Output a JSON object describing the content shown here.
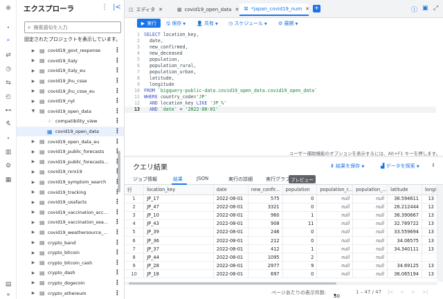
{
  "explorer": {
    "title": "エクスプローラ",
    "search_placeholder": "検索語句を入力",
    "pinned_note": "固定されたプロジェクトを表示しています。",
    "items": [
      {
        "label": "covid19_govt_response",
        "type": "dataset",
        "expanded": false
      },
      {
        "label": "covid19_italy",
        "type": "dataset",
        "expanded": false
      },
      {
        "label": "covid19_italy_eu",
        "type": "dataset",
        "expanded": false
      },
      {
        "label": "covid19_jhu_csse",
        "type": "dataset",
        "expanded": false
      },
      {
        "label": "covid19_jhu_csse_eu",
        "type": "dataset",
        "expanded": false
      },
      {
        "label": "covid19_nyt",
        "type": "dataset",
        "expanded": false
      },
      {
        "label": "covid19_open_data",
        "type": "dataset",
        "expanded": true
      },
      {
        "label": "compatibility_view",
        "type": "view",
        "child": true
      },
      {
        "label": "covid19_open_data",
        "type": "table",
        "child": true,
        "selected": true
      },
      {
        "label": "covid19_open_data_eu",
        "type": "dataset",
        "expanded": false
      },
      {
        "label": "covid19_public_forecasts",
        "type": "dataset",
        "expanded": false
      },
      {
        "label": "covid19_public_forecasts_asi...",
        "type": "dataset",
        "expanded": false
      },
      {
        "label": "covid19_rxrx19",
        "type": "dataset",
        "expanded": false
      },
      {
        "label": "covid19_symptom_search",
        "type": "dataset",
        "expanded": false
      },
      {
        "label": "covid19_tracking",
        "type": "dataset",
        "expanded": false
      },
      {
        "label": "covid19_usafacts",
        "type": "dataset",
        "expanded": false
      },
      {
        "label": "covid19_vaccination_access",
        "type": "dataset",
        "expanded": false
      },
      {
        "label": "covid19_vaccination_search_...",
        "type": "dataset",
        "expanded": false
      },
      {
        "label": "covid19_weathersource_com",
        "type": "dataset",
        "expanded": false
      },
      {
        "label": "crypto_band",
        "type": "dataset",
        "expanded": false
      },
      {
        "label": "crypto_bitcoin",
        "type": "dataset",
        "expanded": false
      },
      {
        "label": "crypto_bitcoin_cash",
        "type": "dataset",
        "expanded": false
      },
      {
        "label": "crypto_dash",
        "type": "dataset",
        "expanded": false
      },
      {
        "label": "crypto_dogecoin",
        "type": "dataset",
        "expanded": false
      },
      {
        "label": "crypto_ethereum",
        "type": "dataset",
        "expanded": false
      }
    ]
  },
  "tabs": [
    {
      "label": "エディタ",
      "icon": "editor-icon",
      "active": false
    },
    {
      "label": "covid19_open_data",
      "icon": "table-icon",
      "active": false
    },
    {
      "label": "*japan_covid19_num",
      "icon": "query-icon",
      "active": true
    }
  ],
  "toolbar": {
    "run": "実行",
    "save": "保存",
    "share": "共有",
    "schedule": "スケジュール",
    "deploy": "展開"
  },
  "code_lines": [
    "SELECT location_key,",
    "  date,",
    "  new_confirmed,",
    "  new_deceased",
    "  population,",
    "  population_rural,",
    "  population_urban,",
    "  latitude,",
    "  longitude",
    "FROM `bigquery-public-data.covid19_open_data.covid19_open_data`",
    "WHERE country_code='JP'",
    "  AND location_key LIKE 'JP_%'",
    "  AND `date` = '2022-08-01'"
  ],
  "current_line": 13,
  "a11y_hint": "ユーザー補助機能のオプションを表示するには、Alt+F1 キーを押します。",
  "results": {
    "title": "クエリ結果",
    "save_results": "結果を保存",
    "explore_data": "データを探索",
    "tabs": [
      "ジョブ情報",
      "結果",
      "JSON",
      "実行の詳細",
      "実行グラフ"
    ],
    "preview_badge": "プレビュー",
    "columns": [
      "行",
      "location_key",
      "date",
      "new_confir...",
      "population",
      "population_r...",
      "population_...",
      "latitude",
      "longi"
    ],
    "rows": [
      [
        "1",
        "JP_17",
        "2022-08-01",
        "575",
        "0",
        "null",
        "null",
        "36.594611",
        "13"
      ],
      [
        "2",
        "JP_47",
        "2022-08-01",
        "3321",
        "0",
        "null",
        "null",
        "26.212444",
        "12"
      ],
      [
        "3",
        "JP_10",
        "2022-08-01",
        "960",
        "1",
        "null",
        "null",
        "36.390667",
        "13"
      ],
      [
        "4",
        "JP_43",
        "2022-08-01",
        "908",
        "11",
        "null",
        "null",
        "32.789722",
        "13"
      ],
      [
        "5",
        "JP_39",
        "2022-08-01",
        "246",
        "0",
        "null",
        "null",
        "33.559694",
        "13"
      ],
      [
        "6",
        "JP_36",
        "2022-08-01",
        "212",
        "0",
        "null",
        "null",
        "34.06575",
        "13"
      ],
      [
        "7",
        "JP_37",
        "2022-08-01",
        "412",
        "1",
        "null",
        "null",
        "34.340111",
        "13"
      ],
      [
        "8",
        "JP_44",
        "2022-08-01",
        "1095",
        "2",
        "null",
        "null",
        "",
        ""
      ],
      [
        "9",
        "JP_28",
        "2022-08-01",
        "2977",
        "9",
        "null",
        "null",
        "34.69125",
        "13"
      ],
      [
        "10",
        "JP_18",
        "2022-08-01",
        "697",
        "0",
        "null",
        "null",
        "36.065194",
        "13"
      ]
    ]
  },
  "pager": {
    "rows_per_page_label": "ページあたりの表示件数:",
    "rows_per_page": "50",
    "range": "1 – 47 / 47"
  }
}
